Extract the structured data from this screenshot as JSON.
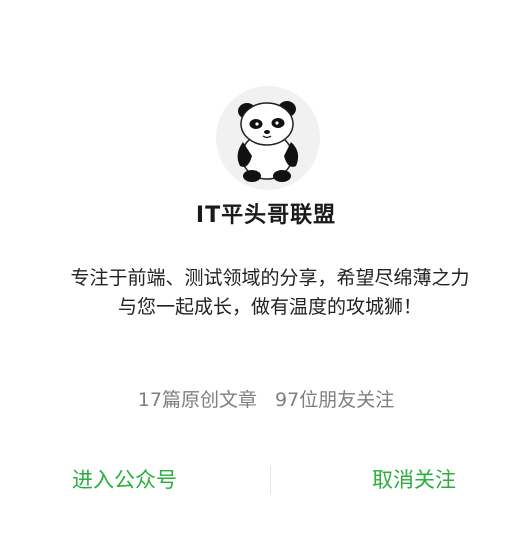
{
  "account": {
    "name": "IT平头哥联盟",
    "description": "专注于前端、测试领域的分享，希望尽绵薄之力 与您一起成长，做有温度的攻城狮！",
    "avatar_icon": "panda-avatar-icon"
  },
  "stats": {
    "articles": "17篇原创文章",
    "followers": "97位朋友关注"
  },
  "actions": {
    "enter_label": "进入公众号",
    "unfollow_label": "取消关注"
  },
  "colors": {
    "accent": "#2aae3c",
    "muted": "#7f7f7f"
  }
}
